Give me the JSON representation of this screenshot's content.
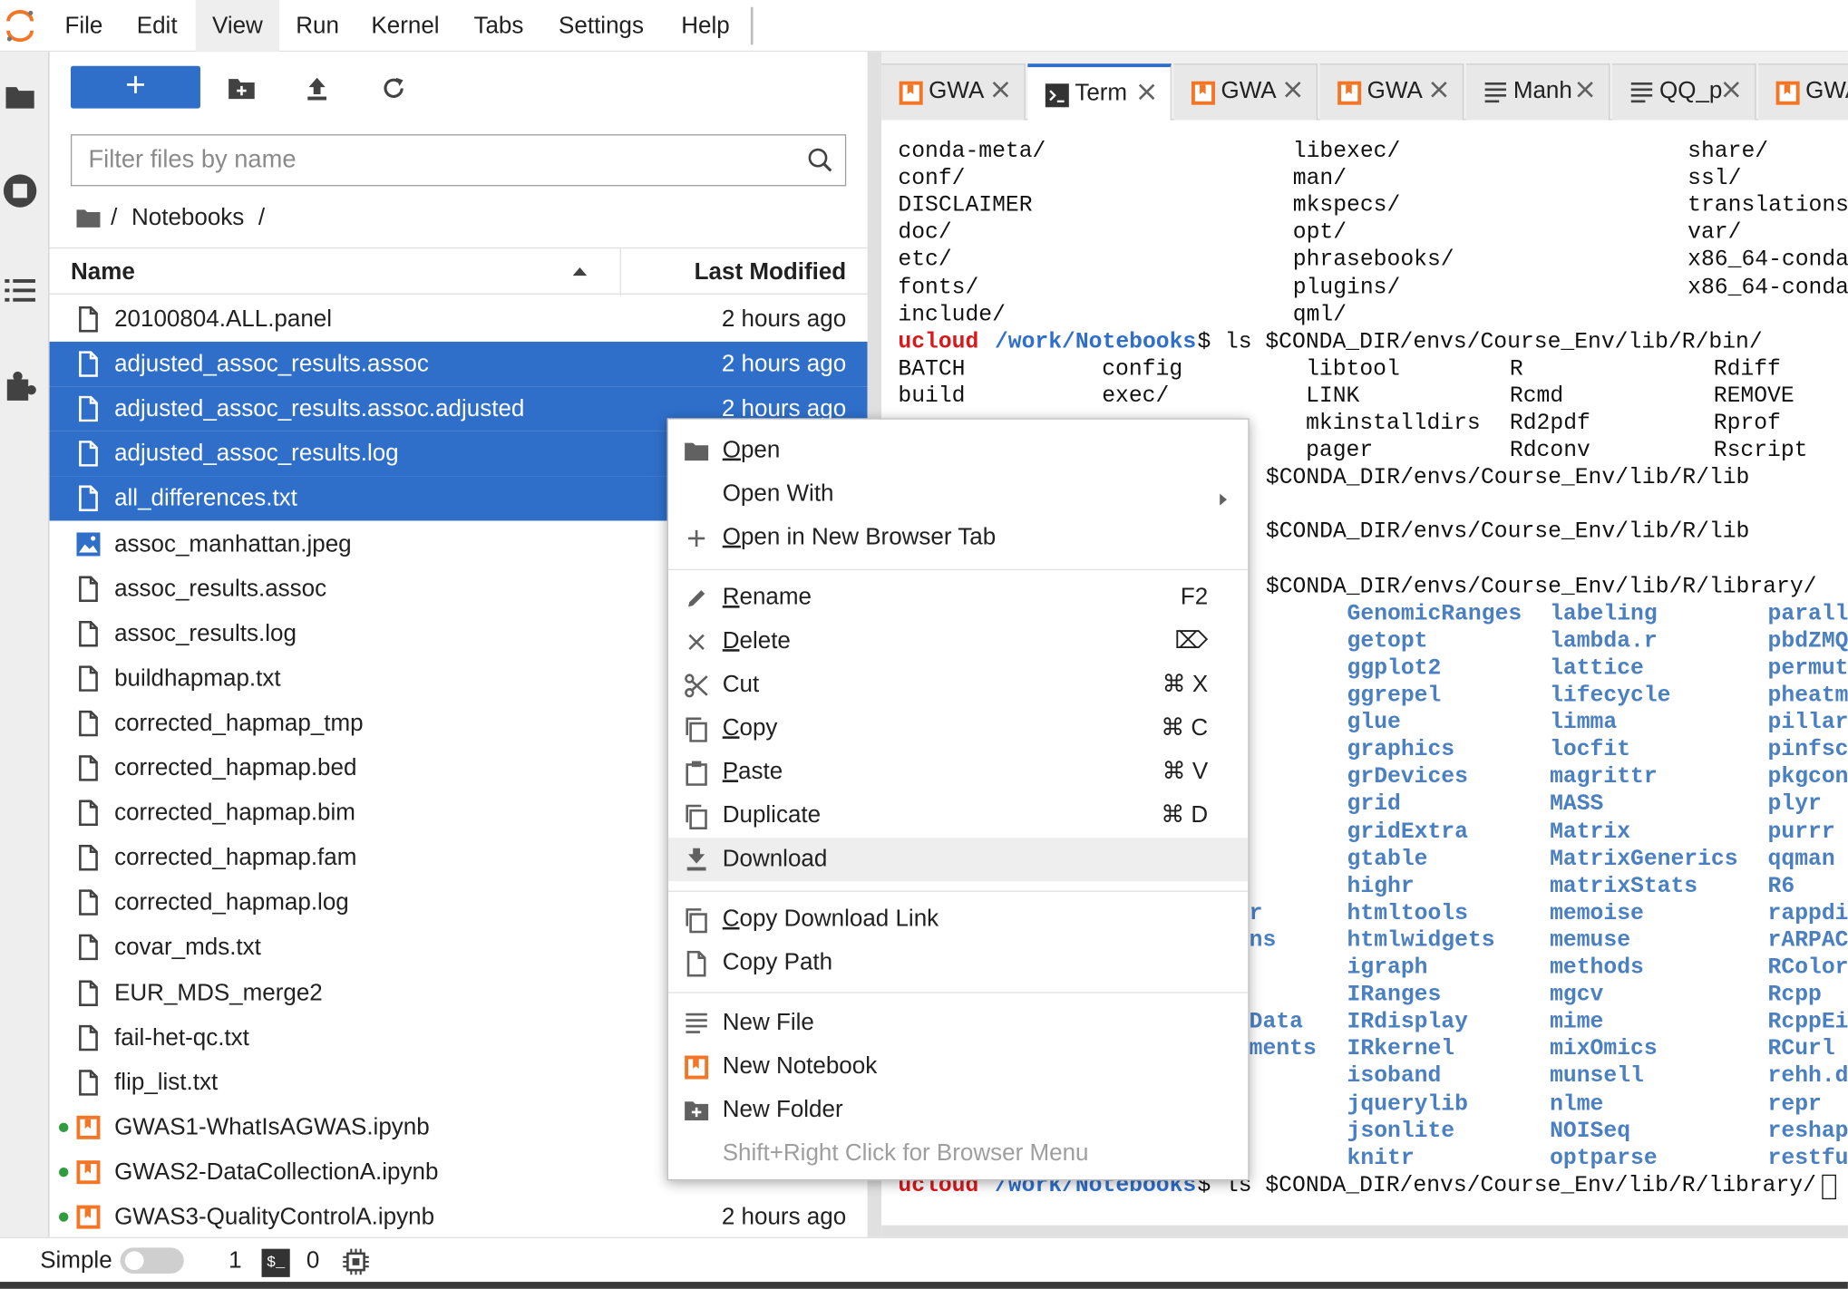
{
  "menubar": {
    "items": [
      "File",
      "Edit",
      "View",
      "Run",
      "Kernel",
      "Tabs",
      "Settings",
      "Help"
    ],
    "active_index": 2
  },
  "filebrowser": {
    "new_button": "+",
    "filter_placeholder": "Filter files by name",
    "breadcrumb_root": "/",
    "breadcrumb_folder": "Notebooks",
    "breadcrumb_tail": "/",
    "col_name": "Name",
    "col_modified": "Last Modified",
    "files": [
      {
        "name": "20100804.ALL.panel",
        "modified": "2 hours ago",
        "icon": "file-icon",
        "selected": false,
        "running": false
      },
      {
        "name": "adjusted_assoc_results.assoc",
        "modified": "2 hours ago",
        "icon": "file-icon",
        "selected": true,
        "running": false
      },
      {
        "name": "adjusted_assoc_results.assoc.adjusted",
        "modified": "2 hours ago",
        "icon": "file-icon",
        "selected": true,
        "running": false
      },
      {
        "name": "adjusted_assoc_results.log",
        "modified": "",
        "icon": "file-icon",
        "selected": true,
        "running": false
      },
      {
        "name": "all_differences.txt",
        "modified": "",
        "icon": "file-icon",
        "selected": true,
        "running": false
      },
      {
        "name": "assoc_manhattan.jpeg",
        "modified": "",
        "icon": "image-icon",
        "selected": false,
        "running": false
      },
      {
        "name": "assoc_results.assoc",
        "modified": "",
        "icon": "file-icon",
        "selected": false,
        "running": false
      },
      {
        "name": "assoc_results.log",
        "modified": "",
        "icon": "file-icon",
        "selected": false,
        "running": false
      },
      {
        "name": "buildhapmap.txt",
        "modified": "",
        "icon": "file-icon",
        "selected": false,
        "running": false
      },
      {
        "name": "corrected_hapmap_tmp",
        "modified": "",
        "icon": "file-icon",
        "selected": false,
        "running": false
      },
      {
        "name": "corrected_hapmap.bed",
        "modified": "",
        "icon": "file-icon",
        "selected": false,
        "running": false
      },
      {
        "name": "corrected_hapmap.bim",
        "modified": "",
        "icon": "file-icon",
        "selected": false,
        "running": false
      },
      {
        "name": "corrected_hapmap.fam",
        "modified": "",
        "icon": "file-icon",
        "selected": false,
        "running": false
      },
      {
        "name": "corrected_hapmap.log",
        "modified": "",
        "icon": "file-icon",
        "selected": false,
        "running": false
      },
      {
        "name": "covar_mds.txt",
        "modified": "",
        "icon": "file-icon",
        "selected": false,
        "running": false
      },
      {
        "name": "EUR_MDS_merge2",
        "modified": "",
        "icon": "file-icon",
        "selected": false,
        "running": false
      },
      {
        "name": "fail-het-qc.txt",
        "modified": "",
        "icon": "file-icon",
        "selected": false,
        "running": false
      },
      {
        "name": "flip_list.txt",
        "modified": "",
        "icon": "file-icon",
        "selected": false,
        "running": false
      },
      {
        "name": "GWAS1-WhatIsAGWAS.ipynb",
        "modified": "",
        "icon": "notebook-icon",
        "selected": false,
        "running": true
      },
      {
        "name": "GWAS2-DataCollectionA.ipynb",
        "modified": "",
        "icon": "notebook-icon",
        "selected": false,
        "running": true
      },
      {
        "name": "GWAS3-QualityControlA.ipynb",
        "modified": "2 hours ago",
        "icon": "notebook-icon",
        "selected": false,
        "running": true
      }
    ]
  },
  "tabs": [
    {
      "label": "GWA",
      "icon": "notebook-icon",
      "current": false
    },
    {
      "label": "Term",
      "icon": "terminal-icon",
      "current": true
    },
    {
      "label": "GWA",
      "icon": "notebook-icon",
      "current": false
    },
    {
      "label": "GWA",
      "icon": "notebook-icon",
      "current": false
    },
    {
      "label": "Manh",
      "icon": "text-file-icon",
      "current": false
    },
    {
      "label": "QQ_p",
      "icon": "text-file-icon",
      "current": false
    },
    {
      "label": "GWA",
      "icon": "notebook-icon",
      "current": false
    }
  ],
  "terminal": {
    "col1": [
      "conda-meta/",
      "conf/",
      "DISCLAIMER",
      "doc/",
      "etc/",
      "fonts/",
      "include/"
    ],
    "col2": [
      "libexec/",
      "man/",
      "mkspecs/",
      "opt/",
      "phrasebooks/",
      "plugins/",
      "qml/"
    ],
    "col3": [
      "share/",
      "ssl/",
      "translations",
      "var/",
      "x86_64-conda",
      "x86_64-conda"
    ],
    "prompt_user": "ucloud",
    "prompt_path": "/work/Notebooks",
    "prompt_symbol": "$",
    "cmd1": " ls $CONDA_DIR/envs/Course_Env/lib/R/bin/",
    "bin_rows": [
      [
        "BATCH",
        "config",
        "libtool",
        "R",
        "Rdiff"
      ],
      [
        "build",
        "exec/",
        "LINK",
        "Rcmd",
        "REMOVE"
      ],
      [
        "",
        "",
        "mkinstalldirs",
        "Rd2pdf",
        "Rprof"
      ],
      [
        "",
        "",
        "pager",
        "Rdconv",
        "Rscript"
      ]
    ],
    "cmd2": "$CONDA_DIR/envs/Course_Env/lib/R/lib",
    "cmd3": "$CONDA_DIR/envs/Course_Env/lib/R/lib",
    "cmd4": "$CONDA_DIR/envs/Course_Env/lib/R/library/",
    "lib_col1": [
      "GenomicRanges",
      "getopt",
      "ggplot2",
      "ggrepel",
      "glue",
      "graphics",
      "grDevices",
      "grid",
      "gridExtra",
      "gtable",
      "highr",
      "htmltools",
      "htmlwidgets",
      "igraph",
      "IRanges",
      "IRdisplay",
      "IRkernel",
      "isoband",
      "jquerylib",
      "jsonlite",
      "knitr"
    ],
    "lib_col2": [
      "labeling",
      "lambda.r",
      "lattice",
      "lifecycle",
      "limma",
      "locfit",
      "magrittr",
      "MASS",
      "Matrix",
      "MatrixGenerics",
      "matrixStats",
      "memoise",
      "memuse",
      "methods",
      "mgcv",
      "mime",
      "mixOmics",
      "munsell",
      "nlme",
      "NOISeq",
      "optparse"
    ],
    "lib_col3": [
      "parall",
      "pbdZMQ",
      "permut",
      "pheatm",
      "pillar",
      "pinfsc",
      "pkgcon",
      "plyr",
      "purrr",
      "qqman",
      "R6",
      "rappdi",
      "rARPAC",
      "RColor",
      "Rcpp",
      "RcppEi",
      "RCurl",
      "rehh.d",
      "repr",
      "reshap",
      "restfu"
    ],
    "partial_left": [
      "r",
      "ns",
      "",
      "",
      "Data",
      "ments"
    ],
    "last_cmd": " ls $CONDA_DIR/envs/Course_Env/lib/R/library/"
  },
  "context_menu": {
    "items": [
      {
        "label": "Open",
        "underline": "O",
        "rest": "pen",
        "shortcut": "",
        "icon": "folder-icon"
      },
      {
        "label": "Open With",
        "underline": "",
        "rest": "Open With",
        "shortcut": "",
        "icon": "",
        "submenu": true
      },
      {
        "label": "Open in New Browser Tab",
        "underline": "O",
        "rest": "pen in New Browser Tab",
        "shortcut": "",
        "icon": "add-icon"
      },
      {
        "label": "Rename",
        "underline": "R",
        "rest": "ename",
        "shortcut": "F2",
        "icon": "pencil-icon"
      },
      {
        "label": "Delete",
        "underline": "D",
        "rest": "elete",
        "shortcut": "⌦",
        "icon": "close-icon"
      },
      {
        "label": "Cut",
        "underline": "",
        "rest": "Cut",
        "shortcut": "⌘ X",
        "icon": "scissors-icon"
      },
      {
        "label": "Copy",
        "underline": "C",
        "rest": "opy",
        "shortcut": "⌘ C",
        "icon": "copy-icon"
      },
      {
        "label": "Paste",
        "underline": "P",
        "rest": "aste",
        "shortcut": "⌘ V",
        "icon": "paste-icon"
      },
      {
        "label": "Duplicate",
        "underline": "",
        "rest": "Duplicate",
        "shortcut": "⌘ D",
        "icon": "copy-icon"
      },
      {
        "label": "Download",
        "underline": "",
        "rest": "Download",
        "shortcut": "",
        "icon": "download-icon"
      },
      {
        "label": "Copy Download Link",
        "underline": "C",
        "rest": "opy Download Link",
        "shortcut": "",
        "icon": "copy-icon"
      },
      {
        "label": "Copy Path",
        "underline": "",
        "rest": "Copy Path",
        "shortcut": "",
        "icon": "file-icon"
      },
      {
        "label": "New File",
        "underline": "",
        "rest": "New File",
        "shortcut": "",
        "icon": "text-file-icon"
      },
      {
        "label": "New Notebook",
        "underline": "",
        "rest": "New Notebook",
        "shortcut": "",
        "icon": "notebook-icon"
      },
      {
        "label": "New Folder",
        "underline": "",
        "rest": "New Folder",
        "shortcut": "",
        "icon": "new-folder-icon"
      },
      {
        "label": "Shift+Right Click for Browser Menu",
        "underline": "",
        "rest": "Shift+Right Click for Browser Menu",
        "shortcut": "",
        "icon": ""
      }
    ],
    "highlighted_index": 9
  },
  "statusbar": {
    "simple_label": "Simple",
    "kernels": "1",
    "terminal_icon_text": "$_",
    "terminals": "0"
  },
  "colors": {
    "accent": "#2f6fca",
    "notebook_orange": "#f37626",
    "prompt_red": "#d7191c",
    "running_green": "#2e9c3f"
  }
}
